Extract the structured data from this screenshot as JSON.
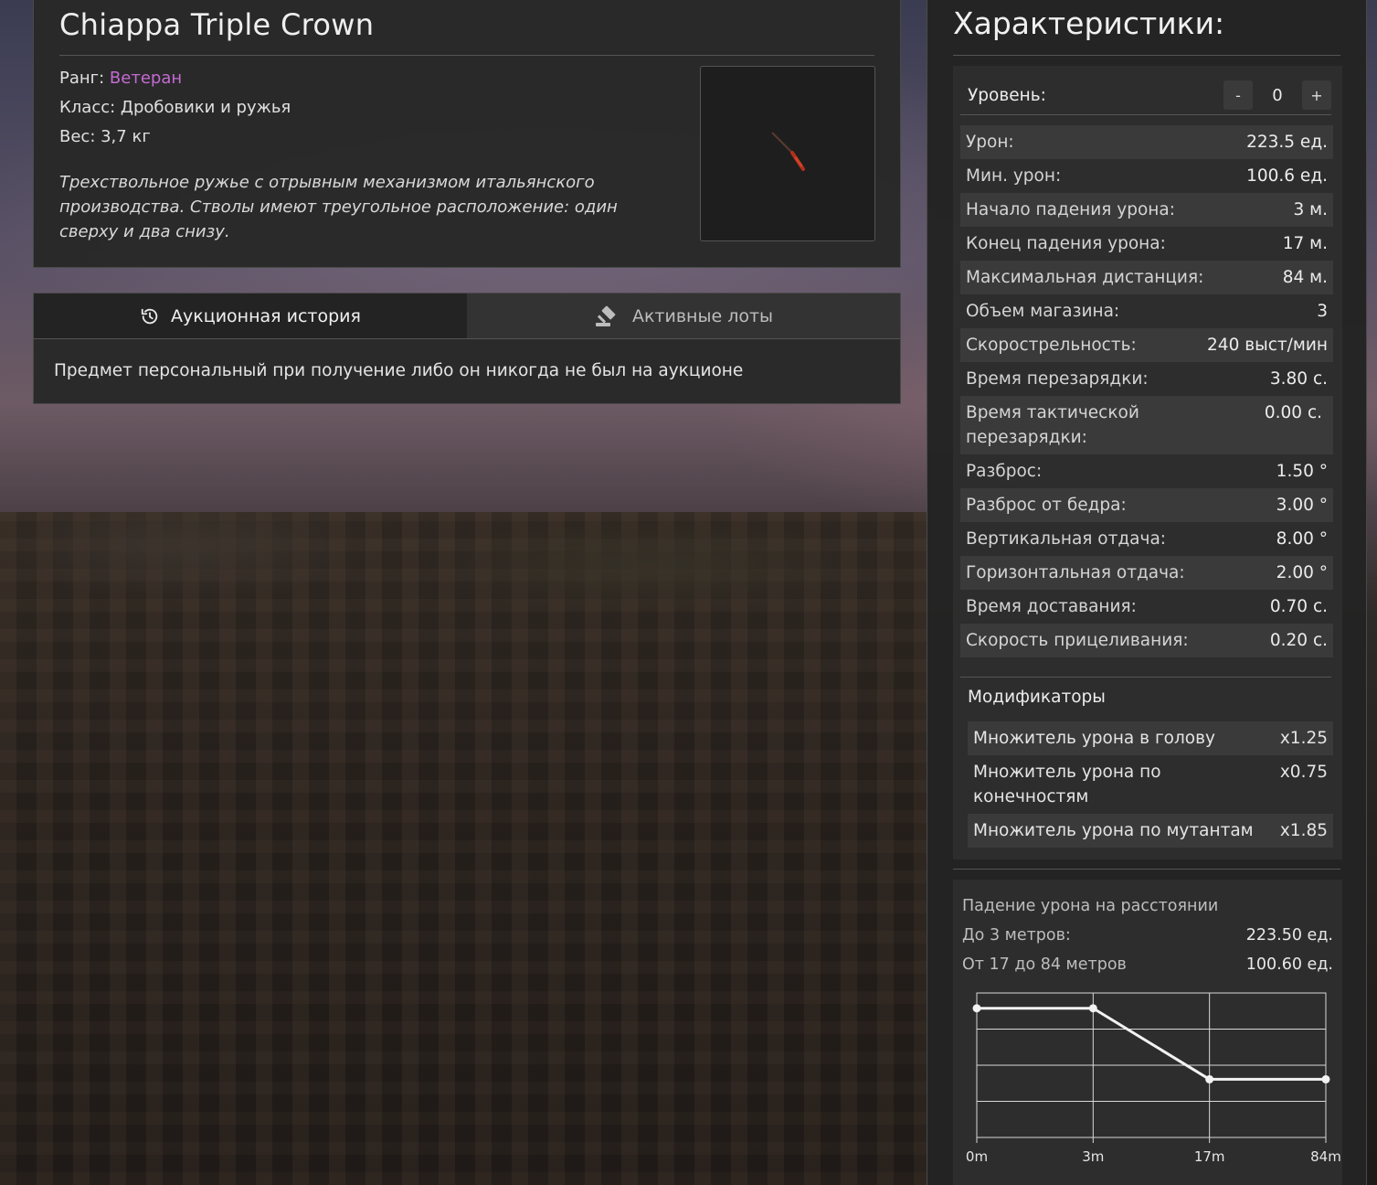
{
  "item": {
    "title": "Chiappa Triple Crown",
    "rank_label": "Ранг:",
    "rank_value": "Ветеран",
    "rank_color": "#c56ad1",
    "class_text": "Класс: Дробовики и ружья",
    "weight_text": "Вес: 3,7 кг",
    "description": "Трехствольное ружье с отрывным механизмом итальянского производства. Стволы имеют треугольное расположение: один сверху и два снизу."
  },
  "auction": {
    "tabs": [
      {
        "label": "Аукционная история",
        "icon": "history-icon",
        "active": true
      },
      {
        "label": "Активные лоты",
        "icon": "gavel-icon",
        "active": false
      }
    ],
    "message": "Предмет персональный при получение либо он никогда не был на аукционе"
  },
  "stats": {
    "title": "Характеристики:",
    "level": {
      "label": "Уровень:",
      "value": "0",
      "minus": "-",
      "plus": "+"
    },
    "rows": [
      {
        "label": "Урон:",
        "value": "223.5 ед."
      },
      {
        "label": "Мин. урон:",
        "value": "100.6 ед."
      },
      {
        "label": "Начало падения урона:",
        "value": "3 м."
      },
      {
        "label": "Конец падения урона:",
        "value": "17 м."
      },
      {
        "label": "Максимальная дистанция:",
        "value": "84 м."
      },
      {
        "label": "Объем магазина:",
        "value": "3"
      },
      {
        "label": "Скорострельность:",
        "value": "240 выст/мин"
      },
      {
        "label": "Время перезарядки:",
        "value": "3.80 с."
      },
      {
        "label": "Время тактической перезарядки:",
        "value": "0.00 с."
      },
      {
        "label": "Разброс:",
        "value": "1.50 °"
      },
      {
        "label": "Разброс от бедра:",
        "value": "3.00 °"
      },
      {
        "label": "Вертикальная отдача:",
        "value": "8.00 °"
      },
      {
        "label": "Горизонтальная отдача:",
        "value": "2.00 °"
      },
      {
        "label": "Время доставания:",
        "value": "0.70 с."
      },
      {
        "label": "Скорость прицеливания:",
        "value": "0.20 с."
      }
    ],
    "modifiers_title": "Модификаторы",
    "modifiers": [
      {
        "label": "Множитель урона в голову",
        "value": "x1.25"
      },
      {
        "label": "Множитель урона по конечностям",
        "value": "x0.75"
      },
      {
        "label": "Множитель урона по мутантам",
        "value": "x1.85"
      }
    ]
  },
  "falloff": {
    "title": "Падение урона на расстоянии",
    "rows": [
      {
        "label": "До 3 метров:",
        "value": "223.50 ед."
      },
      {
        "label": "От 17 до 84 метров",
        "value": "100.60 ед."
      }
    ]
  },
  "chart_data": {
    "type": "line",
    "x_tick_labels": [
      "0m",
      "3m",
      "17m",
      "84m"
    ],
    "series": [
      {
        "values": [
          223.5,
          223.5,
          100.6,
          100.6
        ]
      }
    ],
    "ylim": [
      0,
      250
    ],
    "grid": true,
    "line_color": "#f2f2f2"
  }
}
